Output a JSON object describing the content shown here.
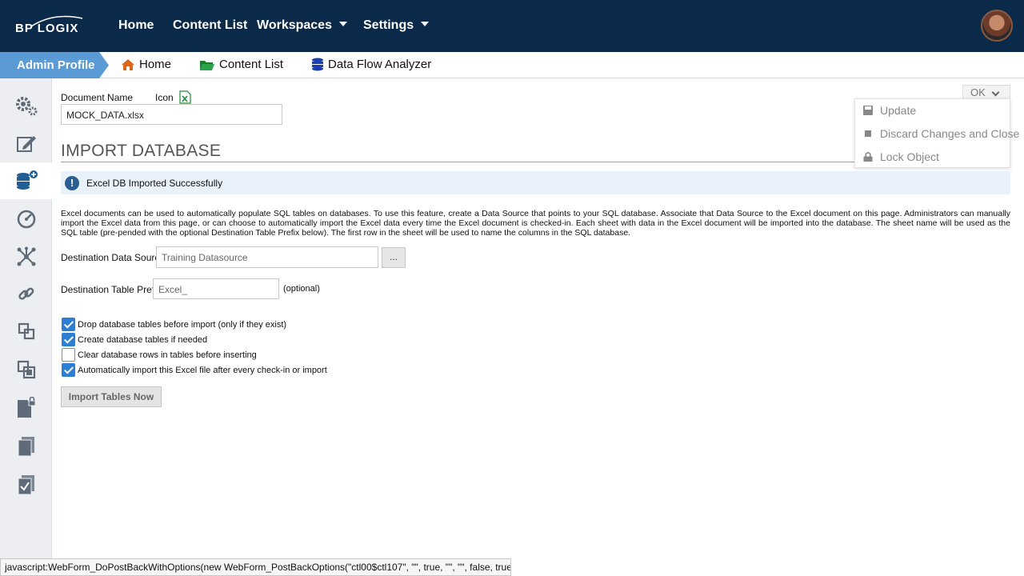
{
  "brand": {
    "logo_text": "BP LOGIX"
  },
  "nav": {
    "home": "Home",
    "content_list": "Content List",
    "workspaces": "Workspaces",
    "settings": "Settings"
  },
  "subbar": {
    "admin_profile": "Admin Profile",
    "home": "Home",
    "content_list": "Content List",
    "data_flow_analyzer": "Data Flow Analyzer"
  },
  "sidebar": {
    "items": [
      "gears-icon",
      "edit-icon",
      "database-add-icon",
      "dashboard-icon",
      "network-icon",
      "link-icon",
      "squares-icon",
      "copy-squares-icon",
      "file-lock-icon",
      "documents-icon",
      "checklist-icon"
    ]
  },
  "document": {
    "name_label": "Document Name",
    "icon_label": "Icon",
    "name_value": "MOCK_DATA.xlsx"
  },
  "section": {
    "title": "IMPORT DATABASE"
  },
  "alert": {
    "message": "Excel DB Imported Successfully"
  },
  "description": "Excel documents can be used to automatically populate SQL tables on databases. To use this feature, create a Data Source that points to your SQL database. Associate that Data Source to the Excel document on this page. Administrators can manually import the Excel data from this page, or can choose to automatically import the Excel data every time the Excel document is checked-in. Each sheet with data in the Excel document will be imported into the database. The sheet name will be used as the SQL table (pre-pended with the optional Destination Table Prefix below). The first row in the sheet will be used to name the columns in the SQL database.",
  "form": {
    "datasource_label": "Destination Data Source",
    "datasource_value": "Training Datasource",
    "browse_label": "...",
    "prefix_label": "Destination Table Prefix",
    "prefix_value": "Excel_",
    "optional_label": "(optional)"
  },
  "options": [
    {
      "label": "Drop database tables before import (only if they exist)",
      "checked": true
    },
    {
      "label": "Create database tables if needed",
      "checked": true
    },
    {
      "label": "Clear database rows in tables before inserting",
      "checked": false
    },
    {
      "label": "Automatically import this Excel file after every check-in or import",
      "checked": true
    }
  ],
  "import_button": "Import Tables Now",
  "actions": {
    "ok": "OK",
    "update": "Update",
    "discard": "Discard Changes and Close",
    "lock": "Lock Object"
  },
  "status_bar": "javascript:WebForm_DoPostBackWithOptions(new WebForm_PostBackOptions(\"ctl00$ctl107\", \"\", true, \"\", \"\", false, true))",
  "colors": {
    "topbar": "#0b2a4a",
    "admin_tab": "#5b9bd5",
    "checkbox": "#2d7fd3",
    "alert_bg": "#e9f2fb",
    "excel_green": "#1e8a3a"
  }
}
